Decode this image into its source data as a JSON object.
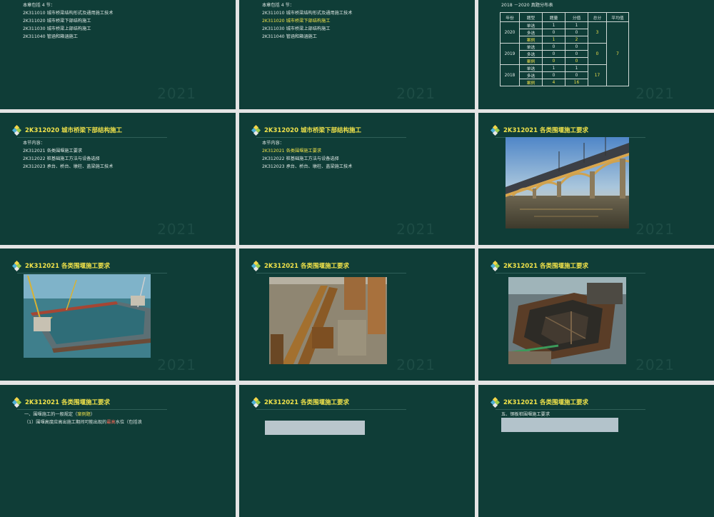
{
  "watermark": "2021",
  "slide1": {
    "intro": "本章包括 4 节：",
    "items": [
      "2K311010  城市桥梁结构形式及通用施工技术",
      "2K311020  城市桥梁下部结构施工",
      "2K311030  城市桥梁上部结构施工",
      "2K311040  管涵和箱涵施工"
    ]
  },
  "slide2": {
    "intro": "本章包括 4 节：",
    "items": [
      "2K311010  城市桥梁结构形式及通用施工技术",
      "2K311020  城市桥梁下部结构施工",
      "2K311030  城市桥梁上部结构施工",
      "2K311040  管涵和箱涵施工"
    ],
    "highlighted_index": 1
  },
  "slide3": {
    "caption": "2018 －2020 真题分布表",
    "headers": [
      "年份",
      "题型",
      "题量",
      "分值",
      "总分",
      "平均值"
    ],
    "years": [
      {
        "year": "2020",
        "total": "3",
        "rows": [
          [
            "单选",
            "1",
            "1"
          ],
          [
            "多选",
            "0",
            "0"
          ],
          [
            "案例",
            "1",
            "2"
          ]
        ]
      },
      {
        "year": "2019",
        "total": "0",
        "rows": [
          [
            "单选",
            "0",
            "0"
          ],
          [
            "多选",
            "0",
            "0"
          ],
          [
            "案例",
            "0",
            "0"
          ]
        ]
      },
      {
        "year": "2018",
        "total": "17",
        "rows": [
          [
            "单选",
            "1",
            "1"
          ],
          [
            "多选",
            "0",
            "0"
          ],
          [
            "案例",
            "4",
            "16"
          ]
        ]
      }
    ],
    "average": "7"
  },
  "slide4": {
    "title": "2K312020  城市桥梁下部结构施工",
    "intro": "本节内容：",
    "items": [
      "2K312021  各类围堰施工要求",
      "2K312022  桩基础施工方法与设备选择",
      "2K312023  承台、桥台、墩柱、盖梁施工技术"
    ]
  },
  "slide5": {
    "title": "2K312020  城市桥梁下部结构施工",
    "intro": "本节内容：",
    "items": [
      "2K312021  各类围堰施工要求",
      "2K312022  桩基础施工方法与设备选择",
      "2K312023  承台、桥台、墩柱、盖梁施工技术"
    ],
    "highlighted_index": 0
  },
  "slide6": {
    "title": "2K312021  各类围堰施工要求"
  },
  "slide7": {
    "title": "2K312021  各类围堰施工要求"
  },
  "slide8": {
    "title": "2K312021  各类围堰施工要求"
  },
  "slide9": {
    "title": "2K312021  各类围堰施工要求"
  },
  "slide10": {
    "title": "2K312021  各类围堰施工要求",
    "line1_pre": "一、围堰施工的一般规定（",
    "line1_hl": "案例题",
    "line1_post": "）",
    "line2_pre": "（1）围堰高度应高出施工期间可能出现的",
    "line2_hl": "最高",
    "line2_post": "水位（包括浪"
  },
  "slide11": {
    "title": "2K312021  各类围堰施工要求"
  },
  "slide12": {
    "title": "2K312021  各类围堰施工要求",
    "subtitle": "五、钢板桩围堰施工要求"
  },
  "colors": {
    "slide_bg": "#0f3d37",
    "title": "#f0e24a",
    "text": "#dfe8e5",
    "gap": "#e4e4e4"
  }
}
